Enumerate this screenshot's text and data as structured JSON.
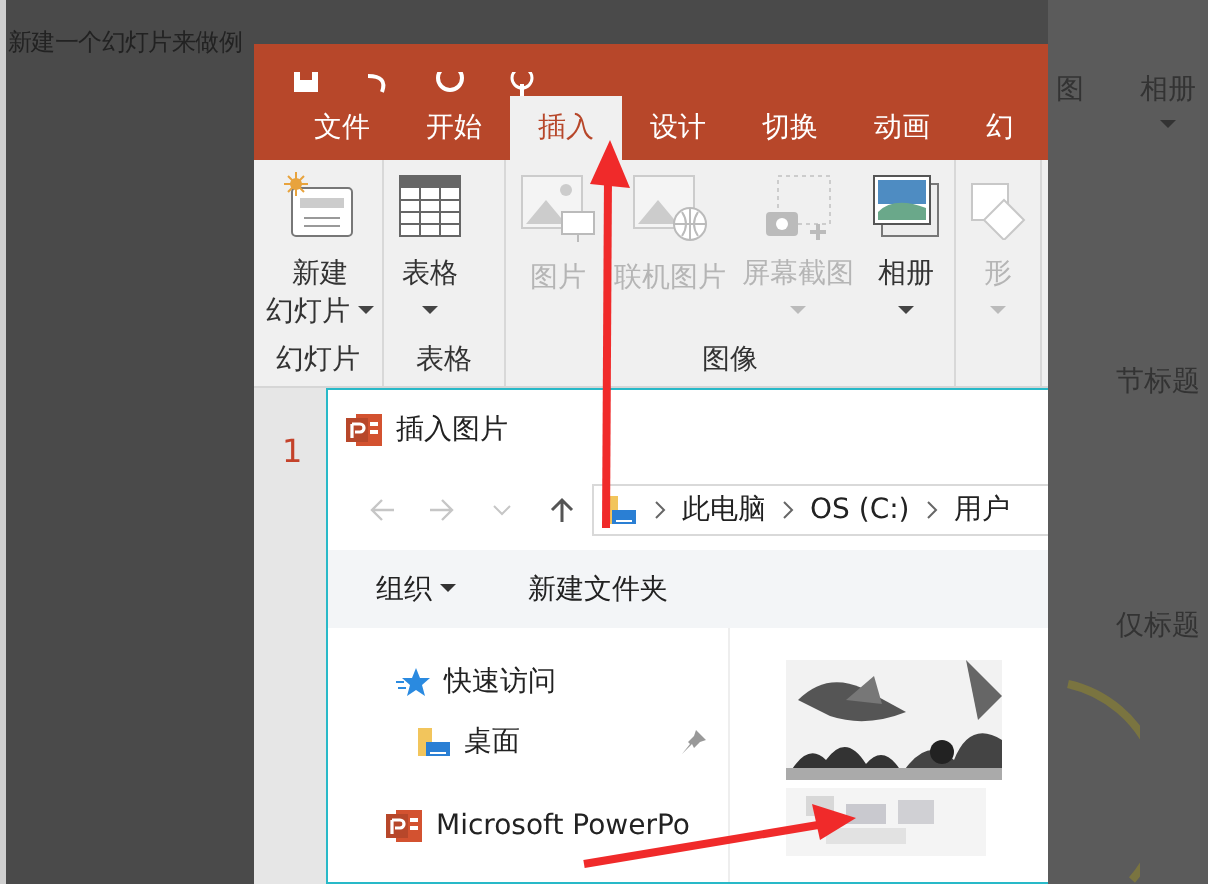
{
  "background": {
    "caption": "新建一个幻灯片来做例",
    "gallery": [
      {
        "label": "图",
        "dropdown": false
      },
      {
        "label": "相册",
        "dropdown": true
      },
      {
        "label": "节标题",
        "dropdown": false
      },
      {
        "label": "仅标题",
        "dropdown": false
      }
    ]
  },
  "ribbon_tabs": [
    {
      "label": "文件",
      "selected": false
    },
    {
      "label": "开始",
      "selected": false
    },
    {
      "label": "插入",
      "selected": true
    },
    {
      "label": "设计",
      "selected": false
    },
    {
      "label": "切换",
      "selected": false
    },
    {
      "label": "动画",
      "selected": false
    },
    {
      "label": "幻",
      "selected": false
    }
  ],
  "ribbon_groups": [
    {
      "label": "幻灯片",
      "commands": [
        {
          "kind": "new-slide",
          "lines": [
            "新建",
            "幻灯片"
          ],
          "dropdown": true,
          "disabled": false
        }
      ]
    },
    {
      "label": "表格",
      "commands": [
        {
          "kind": "table",
          "lines": [
            "表格"
          ],
          "dropdown": true,
          "disabled": false
        }
      ]
    },
    {
      "label": "图像",
      "commands": [
        {
          "kind": "picture",
          "lines": [
            "图片"
          ],
          "dropdown": false,
          "disabled": true
        },
        {
          "kind": "online-picture",
          "lines": [
            "联机图片"
          ],
          "dropdown": false,
          "disabled": true
        },
        {
          "kind": "screenshot",
          "lines": [
            "屏幕截图"
          ],
          "dropdown": true,
          "disabled": true
        },
        {
          "kind": "album",
          "lines": [
            "相册"
          ],
          "dropdown": true,
          "disabled": false
        }
      ]
    },
    {
      "commands": [
        {
          "kind": "shapes",
          "lines": [
            "形"
          ],
          "dropdown": true,
          "disabled": true
        }
      ]
    }
  ],
  "slide_number": "1",
  "dialog": {
    "title": "插入图片",
    "address": [
      "此电脑",
      "OS (C:)",
      "用户"
    ],
    "toolbar": [
      {
        "label": "组织",
        "dropdown": true
      },
      {
        "label": "新建文件夹",
        "dropdown": false
      }
    ],
    "nav_pane": [
      {
        "kind": "star",
        "label": "快速访问",
        "pinned": false
      },
      {
        "kind": "folder",
        "label": "桌面",
        "pinned": true
      },
      {
        "kind": "ppt",
        "label": "Microsoft PowerPo",
        "pinned": false
      }
    ],
    "files": [
      {
        "kind": "picture"
      }
    ]
  }
}
